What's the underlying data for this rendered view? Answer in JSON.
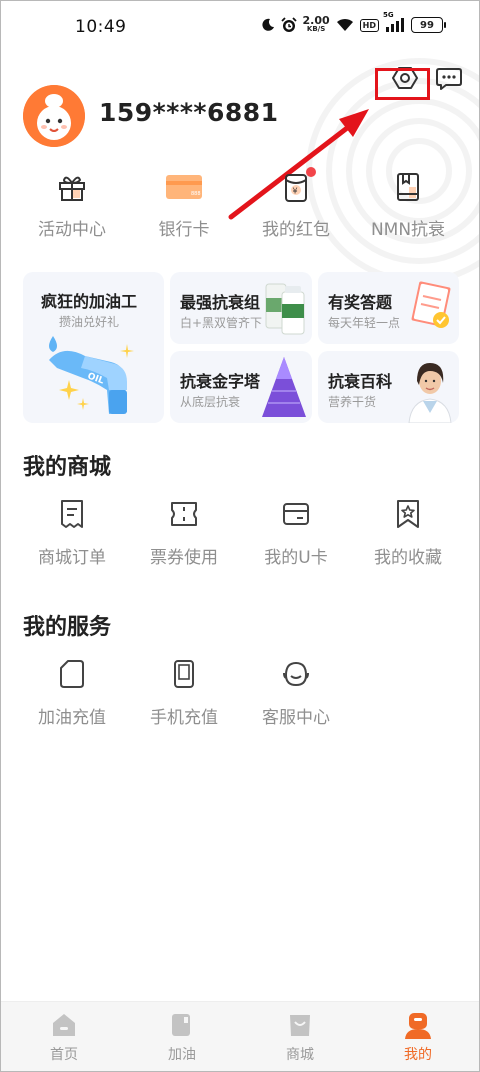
{
  "status_bar": {
    "time": "10:49",
    "net_speed_value": "2.00",
    "net_speed_unit": "KB/S",
    "hd_label": "HD",
    "network_label": "5G",
    "battery": "99",
    "icons": [
      "moon-icon",
      "alarm-icon",
      "wifi-icon",
      "signal-icon",
      "battery-icon"
    ]
  },
  "profile": {
    "phone": "159****6881",
    "avatar_icon": "mascot-avatar"
  },
  "header_actions": {
    "settings_icon": "settings-icon",
    "message_icon": "message-icon"
  },
  "quick_links": [
    {
      "label": "活动中心",
      "icon": "gift-icon"
    },
    {
      "label": "银行卡",
      "icon": "bank-card-icon"
    },
    {
      "label": "我的红包",
      "icon": "red-packet-icon",
      "has_dot": true
    },
    {
      "label": "NMN抗衰",
      "icon": "book-icon"
    }
  ],
  "promos": {
    "fuel": {
      "title": "疯狂的加油工",
      "subtitle": "攒油兑好礼",
      "badge_text": "OIL"
    },
    "anti_aging_group": {
      "title": "最强抗衰组",
      "subtitle": "白+黑双管齐下"
    },
    "quiz": {
      "title": "有奖答题",
      "subtitle": "每天年轻一点"
    },
    "pyramid": {
      "title": "抗衰金字塔",
      "subtitle": "从底层抗衰"
    },
    "encyclopedia": {
      "title": "抗衰百科",
      "subtitle": "营养干货"
    }
  },
  "mall": {
    "title": "我的商城",
    "items": [
      {
        "label": "商城订单",
        "icon": "order-icon"
      },
      {
        "label": "票券使用",
        "icon": "ticket-icon"
      },
      {
        "label": "我的U卡",
        "icon": "card-icon"
      },
      {
        "label": "我的收藏",
        "icon": "favorite-icon"
      }
    ]
  },
  "services": {
    "title": "我的服务",
    "items": [
      {
        "label": "加油充值",
        "icon": "fuel-card-icon"
      },
      {
        "label": "手机充值",
        "icon": "phone-icon"
      },
      {
        "label": "客服中心",
        "icon": "customer-service-icon"
      }
    ]
  },
  "bottom_nav": [
    {
      "label": "首页",
      "icon": "home-icon",
      "active": false
    },
    {
      "label": "加油",
      "icon": "fuel-icon",
      "active": false
    },
    {
      "label": "商城",
      "icon": "shop-bag-icon",
      "active": false
    },
    {
      "label": "我的",
      "icon": "profile-icon",
      "active": true
    }
  ],
  "colors": {
    "accent": "#f06a26",
    "annotation": "#e3141b",
    "inactive_icon": "#c3c3c3",
    "card_bg": "#f4f6fb"
  }
}
